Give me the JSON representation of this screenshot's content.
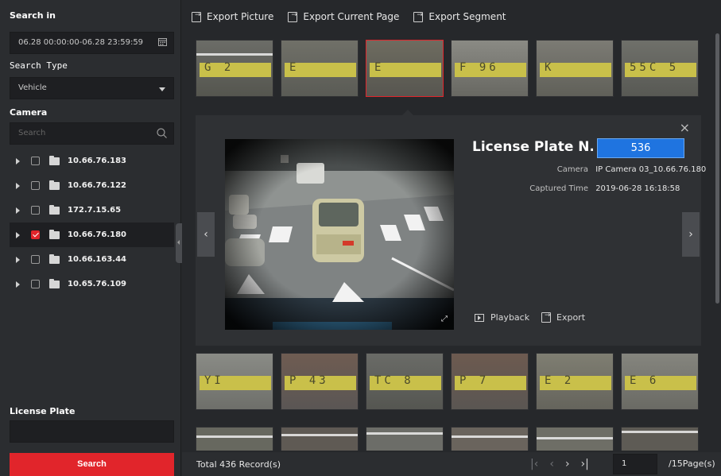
{
  "sidebar": {
    "search_in_label": "Search in",
    "time_range": "06.28 00:00:00-06.28 23:59:59",
    "search_type_label": "Search Type",
    "search_type_value": "Vehicle",
    "camera_label": "Camera",
    "camera_search_placeholder": "Search",
    "cameras": [
      {
        "label": "10.66.76.183",
        "checked": false
      },
      {
        "label": "10.66.76.122",
        "checked": false
      },
      {
        "label": "172.7.15.65",
        "checked": false
      },
      {
        "label": "10.66.76.180",
        "checked": true
      },
      {
        "label": "10.66.163.44",
        "checked": false
      },
      {
        "label": "10.65.76.109",
        "checked": false
      }
    ],
    "license_plate_label": "License Plate",
    "license_plate_value": "",
    "search_button": "Search"
  },
  "toolbar": {
    "export_picture": "Export Picture",
    "export_current_page": "Export Current Page",
    "export_segment": "Export Segment"
  },
  "thumbnails_top": [
    {
      "plate": "G  2",
      "selected": false
    },
    {
      "plate": "E",
      "selected": false
    },
    {
      "plate": "E",
      "selected": true
    },
    {
      "plate": "F  96",
      "selected": false
    },
    {
      "plate": "K",
      "selected": false
    },
    {
      "plate": "55C 5",
      "selected": false
    }
  ],
  "detail": {
    "title": "License Plate N...",
    "plate_value": "536",
    "camera_key": "Camera",
    "camera_value": "IP Camera 03_10.66.76.180",
    "captured_key": "Captured Time",
    "captured_value": "2019-06-28 16:18:58",
    "playback": "Playback",
    "export": "Export",
    "close": "×",
    "prev": "‹",
    "next": "›"
  },
  "thumbnails_bottom": [
    {
      "plate": "YI"
    },
    {
      "plate": "P  43"
    },
    {
      "plate": "TC  8"
    },
    {
      "plate": "P  7"
    },
    {
      "plate": "E  2"
    },
    {
      "plate": "E  6"
    }
  ],
  "footer": {
    "total_records": "Total 436 Record(s)",
    "page_current": "1",
    "page_total": "/15Page(s)"
  },
  "colors": {
    "accent_red": "#e1252b",
    "plate_blue": "#1f74e0"
  }
}
